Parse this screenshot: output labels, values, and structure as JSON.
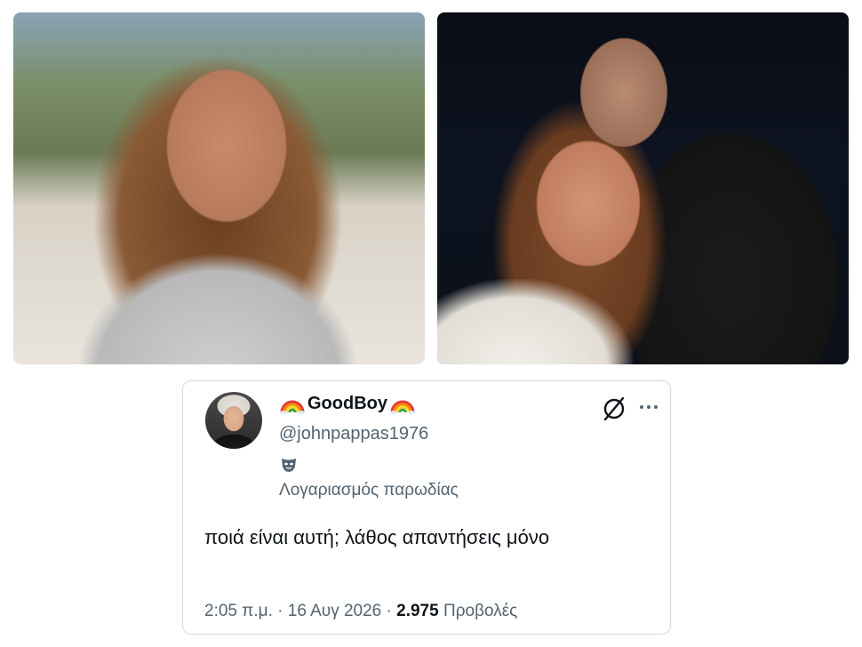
{
  "tweet": {
    "display_name": "GoodBoy",
    "name_emoji": "rainbow-icon",
    "handle": "@johnpappas1976",
    "account_badge_icon": "mask-icon",
    "account_type_label": "Λογαριασμός παρωδίας",
    "text": "ποιά είναι αυτή; λάθος απαντήσεις μόνο",
    "time": "2:05 π.μ.",
    "separator": "·",
    "date": "16 Αυγ 2026",
    "views_count": "2.975",
    "views_label": "Προβολές",
    "actions": {
      "grok_icon": "grok-icon",
      "more_icon": "more-options-icon"
    }
  },
  "colors": {
    "text_primary": "#0f1419",
    "text_secondary": "#536471",
    "border": "#cfd9de"
  }
}
